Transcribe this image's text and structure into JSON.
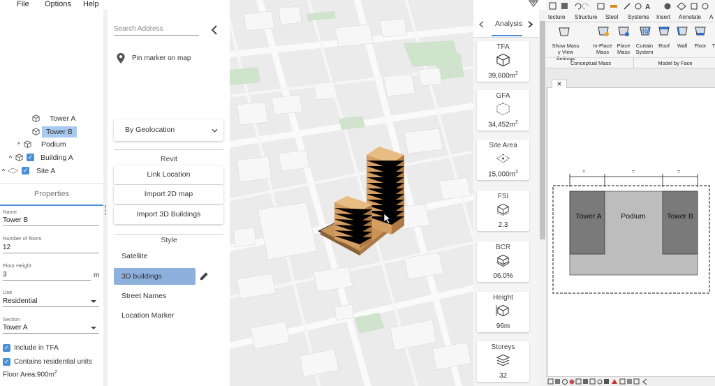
{
  "menu": {
    "file": "File",
    "options": "Options",
    "help": "Help"
  },
  "tree": {
    "items": [
      {
        "label": "Tower A"
      },
      {
        "label": "Tower B"
      },
      {
        "label": "Podium"
      },
      {
        "label": "Building A"
      },
      {
        "label": "Site A"
      }
    ]
  },
  "properties": {
    "title": "Properties",
    "name_label": "Name",
    "name_value": "Tower B",
    "floors_label": "Number of floors",
    "floors_value": "12",
    "height_label": "Floor Height",
    "height_value": "3",
    "height_unit": "m",
    "use_label": "Use",
    "use_value": "Residential",
    "section_label": "Section",
    "section_value": "Tower A",
    "include_tfa": "Include in TFA",
    "contains_res": "Contains residential units",
    "floor_area_label": "Floor Area:",
    "floor_area_value": "900m",
    "floor_area_sup": "2"
  },
  "mid": {
    "search_placeholder": "Search Address",
    "pin_label": "Pin marker on map",
    "geo_select": "By Geolocation",
    "revit_title": "Revit",
    "link_location": "Link Location",
    "import_2d": "Import 2D map",
    "import_3d": "Import 3D Buildings",
    "style_title": "Style",
    "styles": [
      "Satellite",
      "3D buildings",
      "Street Names",
      "Location Marker"
    ],
    "active_style": "3D buildings"
  },
  "analysis": {
    "tab_label": "Analysis",
    "cards": [
      {
        "title": "TFA",
        "value": "39,600m",
        "sup": "2"
      },
      {
        "title": "GFA",
        "value": "34,452m",
        "sup": "2"
      },
      {
        "title": "Site Area",
        "value": "15,000m",
        "sup": "2"
      },
      {
        "title": "FSI",
        "value": "2.3",
        "sup": ""
      },
      {
        "title": "BCR",
        "value": "06.0%",
        "sup": ""
      },
      {
        "title": "Height",
        "value": "96m",
        "sup": ""
      },
      {
        "title": "Storeys",
        "value": "32",
        "sup": ""
      }
    ]
  },
  "revit": {
    "tabs": [
      "tecture",
      "Structure",
      "Steel",
      "Systems",
      "Insert",
      "Annotate",
      "A"
    ],
    "show_mass": "Show Mass",
    "view_settings": "y View Settings",
    "in_place": "In-Place",
    "in_place2": "Mass",
    "place": "Place",
    "place2": "Mass",
    "curtain": "Curtain",
    "curtain2": "System",
    "roof": "Roof",
    "wall": "Wall",
    "floor": "Floor",
    "t": "T",
    "group_conceptual": "Conceptual Mass",
    "group_model": "Model by Face",
    "close": "×",
    "tower_a": "Tower A",
    "podium": "Podium",
    "tower_b": "Tower B",
    "dim_eq": "="
  },
  "colors": {
    "accent": "#4a8fd6",
    "selected": "#a8caf0",
    "active_style": "#8eb0dc",
    "building": "#d9a066",
    "tower_fill": "#7a7a7a",
    "podium_fill": "#bdbdbd"
  }
}
